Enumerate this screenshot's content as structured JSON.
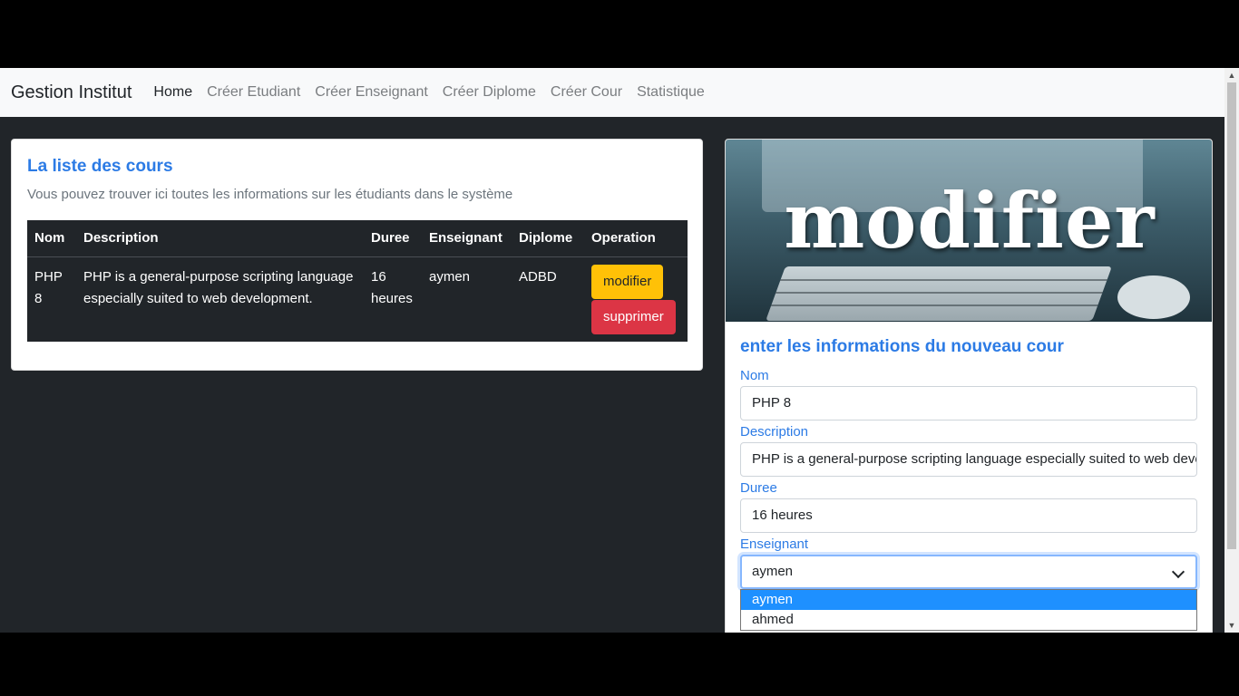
{
  "navbar": {
    "brand": "Gestion Institut",
    "links": [
      "Home",
      "Créer Etudiant",
      "Créer Enseignant",
      "Créer Diplome",
      "Créer Cour",
      "Statistique"
    ]
  },
  "list_card": {
    "title": "La liste des cours",
    "subtitle": "Vous pouvez trouver ici toutes les informations sur les étudiants dans le système",
    "columns": [
      "Nom",
      "Description",
      "Duree",
      "Enseignant",
      "Diplome",
      "Operation"
    ],
    "rows": [
      {
        "nom": "PHP 8",
        "description": "PHP is a general-purpose scripting language especially suited to web development.",
        "duree": "16 heures",
        "enseignant": "aymen",
        "diplome": "ADBD",
        "edit_label": "modifier",
        "delete_label": "supprimer"
      }
    ]
  },
  "form_card": {
    "hero_text": "modifier",
    "title": "enter les informations du nouveau cour",
    "nom_label": "Nom",
    "nom_value": "PHP 8",
    "description_label": "Description",
    "description_value": "PHP is a general-purpose scripting language especially suited to web development.",
    "duree_label": "Duree",
    "duree_value": "16 heures",
    "enseignant_label": "Enseignant",
    "enseignant_value": "aymen",
    "enseignant_options": [
      "aymen",
      "ahmed"
    ]
  },
  "colors": {
    "accent": "#2c7be5",
    "warning": "#ffc107",
    "danger": "#dc3545",
    "page_bg": "#212529"
  }
}
